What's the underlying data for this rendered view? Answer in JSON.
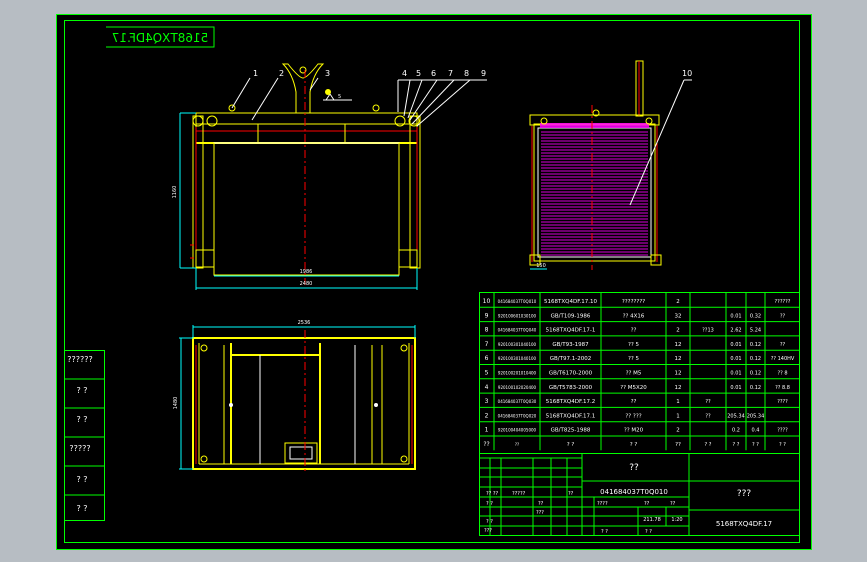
{
  "colors": {
    "background": "#000000",
    "frame": "#00ff00",
    "part": "#ffff00",
    "dim": "#00ffff",
    "red": "#ff0000",
    "magenta": "#ff00ff",
    "white": "#ffffff"
  },
  "title_stamp": "5168TXQ4DF.17",
  "front_view": {
    "balloons": [
      "1",
      "2",
      "3",
      "4",
      "5",
      "6",
      "7",
      "8",
      "9"
    ],
    "dim_height": "1160",
    "dim_inner": "1986",
    "dim_width": "2480"
  },
  "side_view": {
    "balloon": "10",
    "dim_small": "150"
  },
  "top_view": {
    "dim_width": "2536",
    "dim_height": "1480"
  },
  "side_strip": [
    "??????",
    "? ?",
    "? ?",
    "?????",
    "? ?",
    "? ?"
  ],
  "bom": [
    {
      "no": "10",
      "code": "041684037T0Q010",
      "name": "5168TXQ4DF.17.10",
      "desc": "????????",
      "qty": "2",
      "c6": "",
      "c7": "",
      "c8": "",
      "c9": "??????"
    },
    {
      "no": "9",
      "code": "920100601030100",
      "name": "GB/T109-1986",
      "desc": "?? 4X16",
      "qty": "32",
      "c6": "",
      "c7": "0.01",
      "c8": "0.32",
      "c9": "??"
    },
    {
      "no": "8",
      "code": "041684037T0Q040",
      "name": "5168TXQ4DF.17-1",
      "desc": "??",
      "qty": "2",
      "c6": "??13",
      "c7": "2.62",
      "c8": "5.24",
      "c9": ""
    },
    {
      "no": "7",
      "code": "920100301040100",
      "name": "GB/T93-1987",
      "desc": "?? 5",
      "qty": "12",
      "c6": "",
      "c7": "0.01",
      "c8": "0.12",
      "c9": "??"
    },
    {
      "no": "6",
      "code": "920100301040100",
      "name": "GB/T97.1-2002",
      "desc": "?? 5",
      "qty": "12",
      "c6": "",
      "c7": "0.01",
      "c8": "0.12",
      "c9": "?? 140HV"
    },
    {
      "no": "5",
      "code": "920100201010400",
      "name": "GB/T6170-2000",
      "desc": "?? M5",
      "qty": "12",
      "c6": "",
      "c7": "0.01",
      "c8": "0.12",
      "c9": "?? 8"
    },
    {
      "no": "4",
      "code": "920100102020400",
      "name": "GB/T5783-2000",
      "desc": "?? M5X20",
      "qty": "12",
      "c6": "",
      "c7": "0.01",
      "c8": "0.12",
      "c9": "?? 8.8"
    },
    {
      "no": "3",
      "code": "041684037T0Q030",
      "name": "5168TXQ4DF.17.2",
      "desc": "??",
      "qty": "1",
      "c6": "??",
      "c7": "",
      "c8": "",
      "c9": "????"
    },
    {
      "no": "2",
      "code": "041684037T0Q020",
      "name": "5168TXQ4DF.17.1",
      "desc": "?? ???",
      "qty": "1",
      "c6": "??",
      "c7": "205.34",
      "c8": "205.34",
      "c9": ""
    },
    {
      "no": "1",
      "code": "920100404005000",
      "name": "GB/T825-1988",
      "desc": "?? M20",
      "qty": "2",
      "c6": "",
      "c7": "0.2",
      "c8": "0.4",
      "c9": "????"
    }
  ],
  "bom_header": {
    "no": "??",
    "code": "??",
    "name": "? ?",
    "desc": "? ?",
    "qty": "??",
    "c6": "? ?",
    "c7": "? ?",
    "c8": "? ?",
    "c9": "? ?",
    "c7b": "? ?",
    "c8b": "? ?"
  },
  "title_block": {
    "title": "??",
    "drawing_code": "041684037T0Q010",
    "name_cell": "???",
    "drawing_no": "5168TXQ4DF.17",
    "left_labels": [
      "?? ??",
      "? ?",
      "? ?",
      "???"
    ],
    "mid_labels": [
      "?????",
      "??",
      "???"
    ],
    "scale_labels": [
      "????",
      "??",
      "??",
      "??"
    ],
    "weight": "211.78",
    "scale": "1:20",
    "sheet": [
      "? ?",
      "? ?"
    ]
  }
}
